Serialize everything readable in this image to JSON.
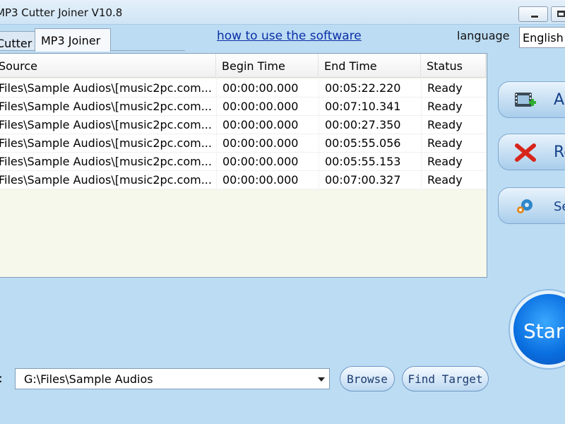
{
  "window": {
    "title": "MP3 Cutter Joiner V10.8"
  },
  "tabs": [
    {
      "label": "Cutter"
    },
    {
      "label": "MP3 Joiner"
    }
  ],
  "header": {
    "howto_link": "how to use the software",
    "language_label": "language",
    "language_value": "English"
  },
  "table": {
    "columns": [
      "Source",
      "Begin Time",
      "End Time",
      "Status"
    ],
    "rows": [
      {
        "source": "Files\\Sample Audios\\[music2pc.com...",
        "begin": "00:00:00.000",
        "end": "00:05:22.220",
        "status": "Ready"
      },
      {
        "source": "Files\\Sample Audios\\[music2pc.com...",
        "begin": "00:00:00.000",
        "end": "00:07:10.341",
        "status": "Ready"
      },
      {
        "source": "Files\\Sample Audios\\[music2pc.com...",
        "begin": "00:00:00.000",
        "end": "00:00:27.350",
        "status": "Ready"
      },
      {
        "source": "Files\\Sample Audios\\[music2pc.com...",
        "begin": "00:00:00.000",
        "end": "00:05:55.056",
        "status": "Ready"
      },
      {
        "source": "Files\\Sample Audios\\[music2pc.com...",
        "begin": "00:00:00.000",
        "end": "00:05:55.153",
        "status": "Ready"
      },
      {
        "source": "Files\\Sample Audios\\[music2pc.com...",
        "begin": "00:00:00.000",
        "end": "00:07:00.327",
        "status": "Ready"
      }
    ]
  },
  "side_buttons": {
    "add": {
      "label": "A",
      "icon": "film-add-icon"
    },
    "remove": {
      "label": "Re",
      "icon": "red-x-icon"
    },
    "settings": {
      "label": "Set",
      "icon": "gear-icon"
    }
  },
  "start": {
    "label": "Star"
  },
  "output": {
    "colon": ":",
    "path": "G:\\Files\\Sample Audios",
    "browse_label": "Browse",
    "find_target_label": "Find Target"
  }
}
